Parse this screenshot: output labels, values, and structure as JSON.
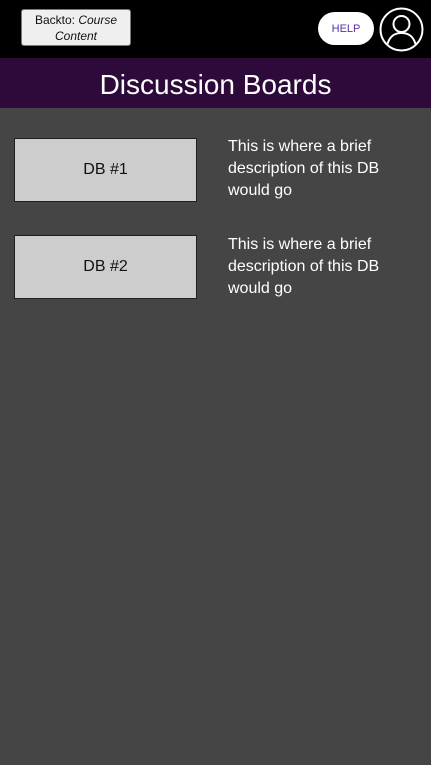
{
  "header": {
    "back_prefix": "Backto:",
    "back_target_line1": "Course",
    "back_target_line2": "Content",
    "help_label": "HELP",
    "avatar_icon": "user-circle-icon"
  },
  "title": "Discussion Boards",
  "boards": [
    {
      "label": "DB #1",
      "description": "This is where a brief description of this DB would go"
    },
    {
      "label": "DB #2",
      "description": "This is where a brief description of this DB would go"
    }
  ],
  "colors": {
    "topbar": "#000000",
    "title_bar": "#2e0a3a",
    "background": "#454545",
    "board_button": "#cdcdcd",
    "help_text": "#5a2ea8"
  }
}
